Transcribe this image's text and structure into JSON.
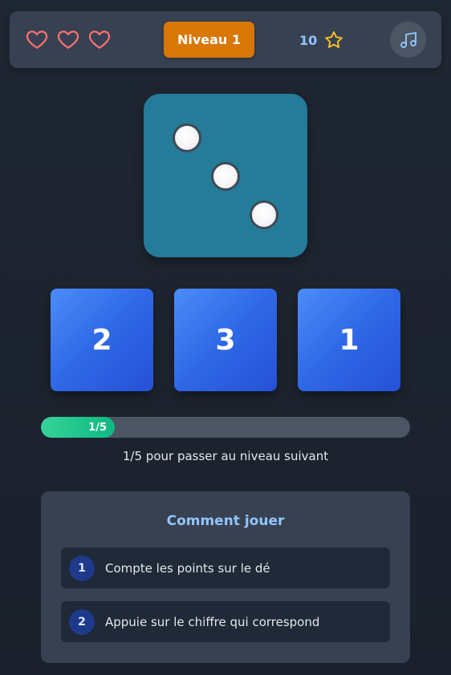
{
  "header": {
    "lives": {
      "total": 3,
      "icon": "heart-outline-icon",
      "color": "#f87171"
    },
    "level_label": "Niveau 1",
    "level_color": "#d97706",
    "score": "10",
    "score_icon": "star-outline-icon",
    "star_color": "#fbbf24",
    "music_icon": "music-note-icon"
  },
  "die": {
    "pips": 3,
    "color": "#247b9a"
  },
  "answers": [
    {
      "label": "2"
    },
    {
      "label": "3"
    },
    {
      "label": "1"
    }
  ],
  "progress": {
    "current": 1,
    "total": 5,
    "fraction": 0.2,
    "label": "1/5",
    "caption": "1/5 pour passer au niveau suivant"
  },
  "how_to_play": {
    "title": "Comment jouer",
    "steps": [
      {
        "number": "1",
        "text": "Compte les points sur le dé"
      },
      {
        "number": "2",
        "text": "Appuie sur le chiffre qui correspond"
      }
    ]
  }
}
